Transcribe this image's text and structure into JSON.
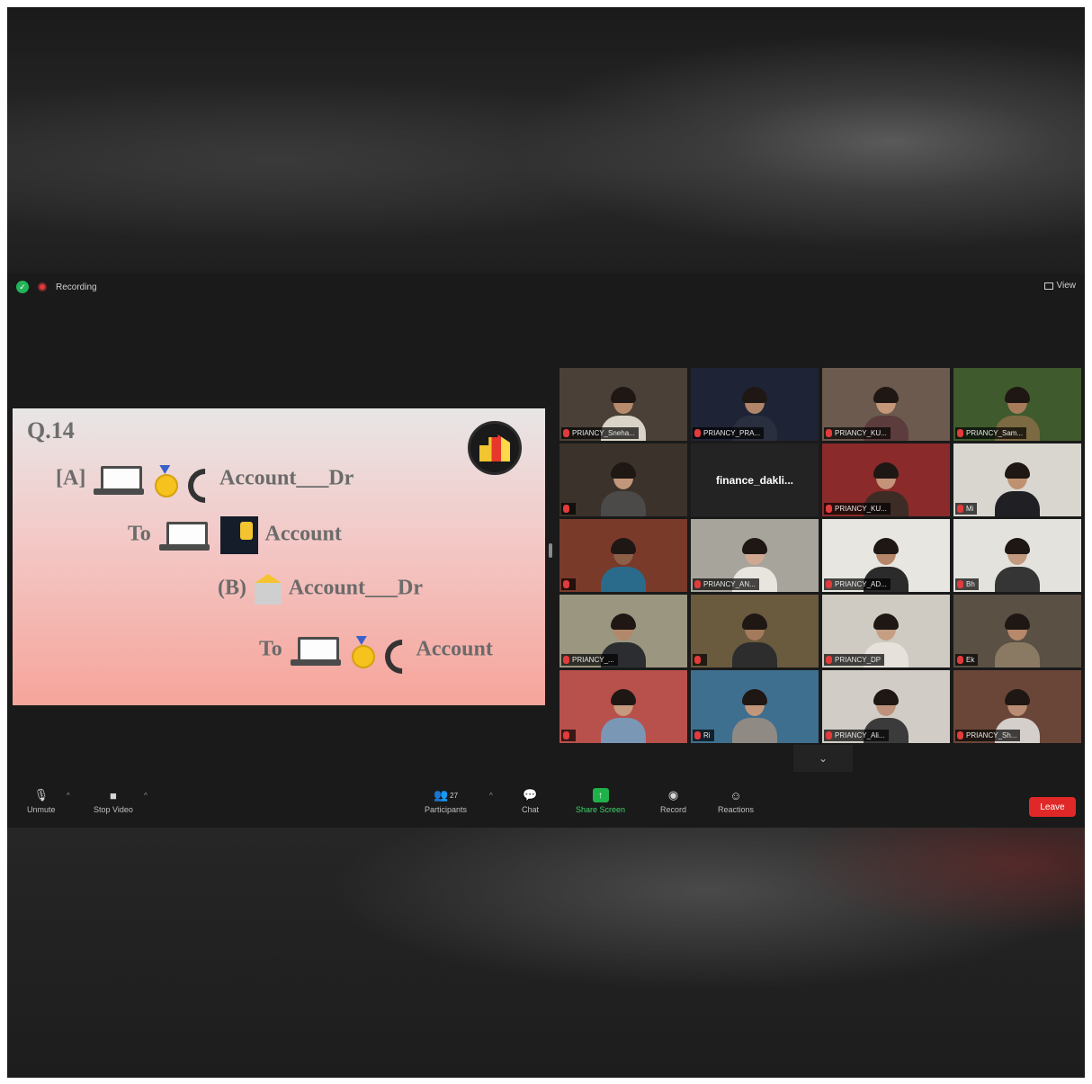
{
  "topbar": {
    "recording_label": "Recording",
    "view_label": "View"
  },
  "slide": {
    "question": "Q.14",
    "line_a_prefix": "[A]",
    "line_a_suffix": "Account___Dr",
    "line_b_prefix": "To",
    "line_b_suffix": "Account",
    "line_c_prefix": "(B)",
    "line_c_suffix": "Account___Dr",
    "line_d_prefix": "To",
    "line_d_suffix": "Account"
  },
  "participants": [
    {
      "name": "PRIANCY_Sneha...",
      "active": true,
      "bg": "#4a4037",
      "shirt": "#d9d2c6",
      "skin": "#b88a6c"
    },
    {
      "name": "PRIANCY_PRA...",
      "bg": "#1e2436",
      "shirt": "#2a2f3f",
      "skin": "#b08569"
    },
    {
      "name": "PRIANCY_KU...",
      "bg": "#6b5a4d",
      "shirt": "#5c3c3c",
      "skin": "#c4977a"
    },
    {
      "name": "PRIANCY_Sam...",
      "bg": "#3f5a2c",
      "shirt": "#7c6a42",
      "skin": "#a67c5b"
    },
    {
      "name": "",
      "bg": "#3a322b",
      "shirt": "#4b4a48",
      "skin": "#c1967a"
    },
    {
      "name": "",
      "text": "finance_dakli...",
      "bg": "#232323"
    },
    {
      "name": "PRIANCY_KU...",
      "bg": "#8a2a2a",
      "shirt": "#3d2b26",
      "skin": "#c59378"
    },
    {
      "name": "Mi",
      "bg": "#d9d6d0",
      "shirt": "#1f1f24",
      "skin": "#bf916f"
    },
    {
      "name": "",
      "bg": "#7a3a2a",
      "shirt": "#2a6a8a",
      "skin": "#8c6046"
    },
    {
      "name": "PRIANCY_AN...",
      "bg": "#a7a49c",
      "shirt": "#e8e4de",
      "skin": "#d0a891"
    },
    {
      "name": "PRIANCY_AD...",
      "bg": "#e8e6e0",
      "shirt": "#2b2b2b",
      "skin": "#b58668"
    },
    {
      "name": "Bh",
      "bg": "#e4e2dd",
      "shirt": "#353535",
      "skin": "#c19a80"
    },
    {
      "name": "PRIANCY_...",
      "bg": "#9a9680",
      "shirt": "#2c2d31",
      "skin": "#b3876a"
    },
    {
      "name": "",
      "bg": "#6a5a3e",
      "shirt": "#2d2d2d",
      "skin": "#a47a5c"
    },
    {
      "name": "PRIANCY_DP",
      "bg": "#cfcbc2",
      "shirt": "#e6e2db",
      "skin": "#c69e84"
    },
    {
      "name": "Ek",
      "bg": "#5a5044",
      "shirt": "#8a7a63",
      "skin": "#b7886a"
    },
    {
      "name": "",
      "bg": "#b8504c",
      "shirt": "#7a97b5",
      "skin": "#c59a7f"
    },
    {
      "name": "Ri",
      "bg": "#3f6f8f",
      "shirt": "#8f8a84",
      "skin": "#c2967a"
    },
    {
      "name": "PRIANCY_Ali...",
      "bg": "#d1cdc6",
      "shirt": "#3b3b3b",
      "skin": "#be927a"
    },
    {
      "name": "PRIANCY_Sh...",
      "bg": "#6a4638",
      "shirt": "#d4cfca",
      "skin": "#b88d74"
    }
  ],
  "toolbar": {
    "mute_label": "Unmute",
    "video_label": "Stop Video",
    "participants_label": "Participants",
    "participants_count": "27",
    "chat_label": "Chat",
    "share_label": "Share Screen",
    "record_label": "Record",
    "reactions_label": "Reactions",
    "leave_label": "Leave"
  },
  "icons": {
    "security": "shield-icon",
    "recording": "record-dot-icon",
    "view": "grid-view-icon",
    "mute": "microphone-muted-icon",
    "video": "video-camera-icon",
    "participants": "people-icon",
    "chat": "chat-bubble-icon",
    "share": "share-screen-icon",
    "record": "record-icon",
    "reactions": "smiley-icon"
  },
  "colors": {
    "share_green": "#1fb14a",
    "leave_red": "#e02828",
    "active_speaker": "#c6d64b"
  }
}
